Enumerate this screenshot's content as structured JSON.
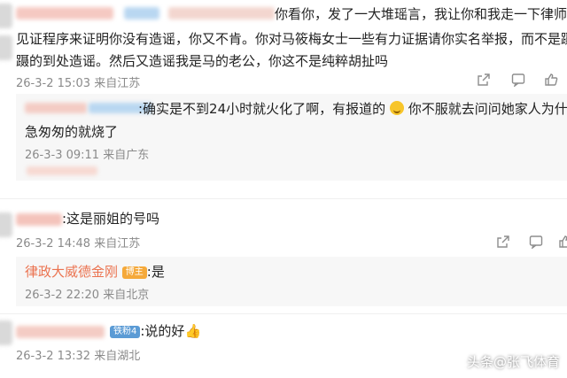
{
  "comments": [
    {
      "name": "comment-1",
      "lines": [
        "你看你，发了一大堆瑶言，我让你和我走一下律师",
        "见证程序来证明你没有造谣，你又不肯。你对马筱梅女士一些有力证据请你实名举报，而不是蹑",
        "蹑的到处造谣。然后又造谣我是马的老公，你这不是纯粹胡扯吗"
      ],
      "meta": "26-3-2 15:03 来自江苏",
      "reply": {
        "lines": [
          ":确实是不到24小时就火化了啊，有报道的",
          "你不服就去问问她家人为什么",
          "急匆匆的就烧了"
        ],
        "meta": "26-3-3 09:11 来自广东"
      }
    },
    {
      "name": "comment-2",
      "text": ":这是丽姐的号吗",
      "meta": "26-3-2 14:48 来自江苏",
      "reply": {
        "nick": "律政大威德金刚",
        "badge": "博主",
        "text": ":是",
        "meta": "26-3-2 22:20 来自北京"
      }
    },
    {
      "name": "comment-3",
      "badge": "铁粉4",
      "text": ":说的好",
      "meta": "26-3-2 13:32 来自湖北"
    }
  ],
  "watermark": "头条@张飞体育",
  "icons": {
    "share": "share-icon",
    "comment": "comment-icon",
    "like": "thumbs-up-icon"
  },
  "colors": {
    "nick": "#eb7350",
    "meta": "#8a8a8a",
    "reply_bg": "#f7f7f7"
  }
}
